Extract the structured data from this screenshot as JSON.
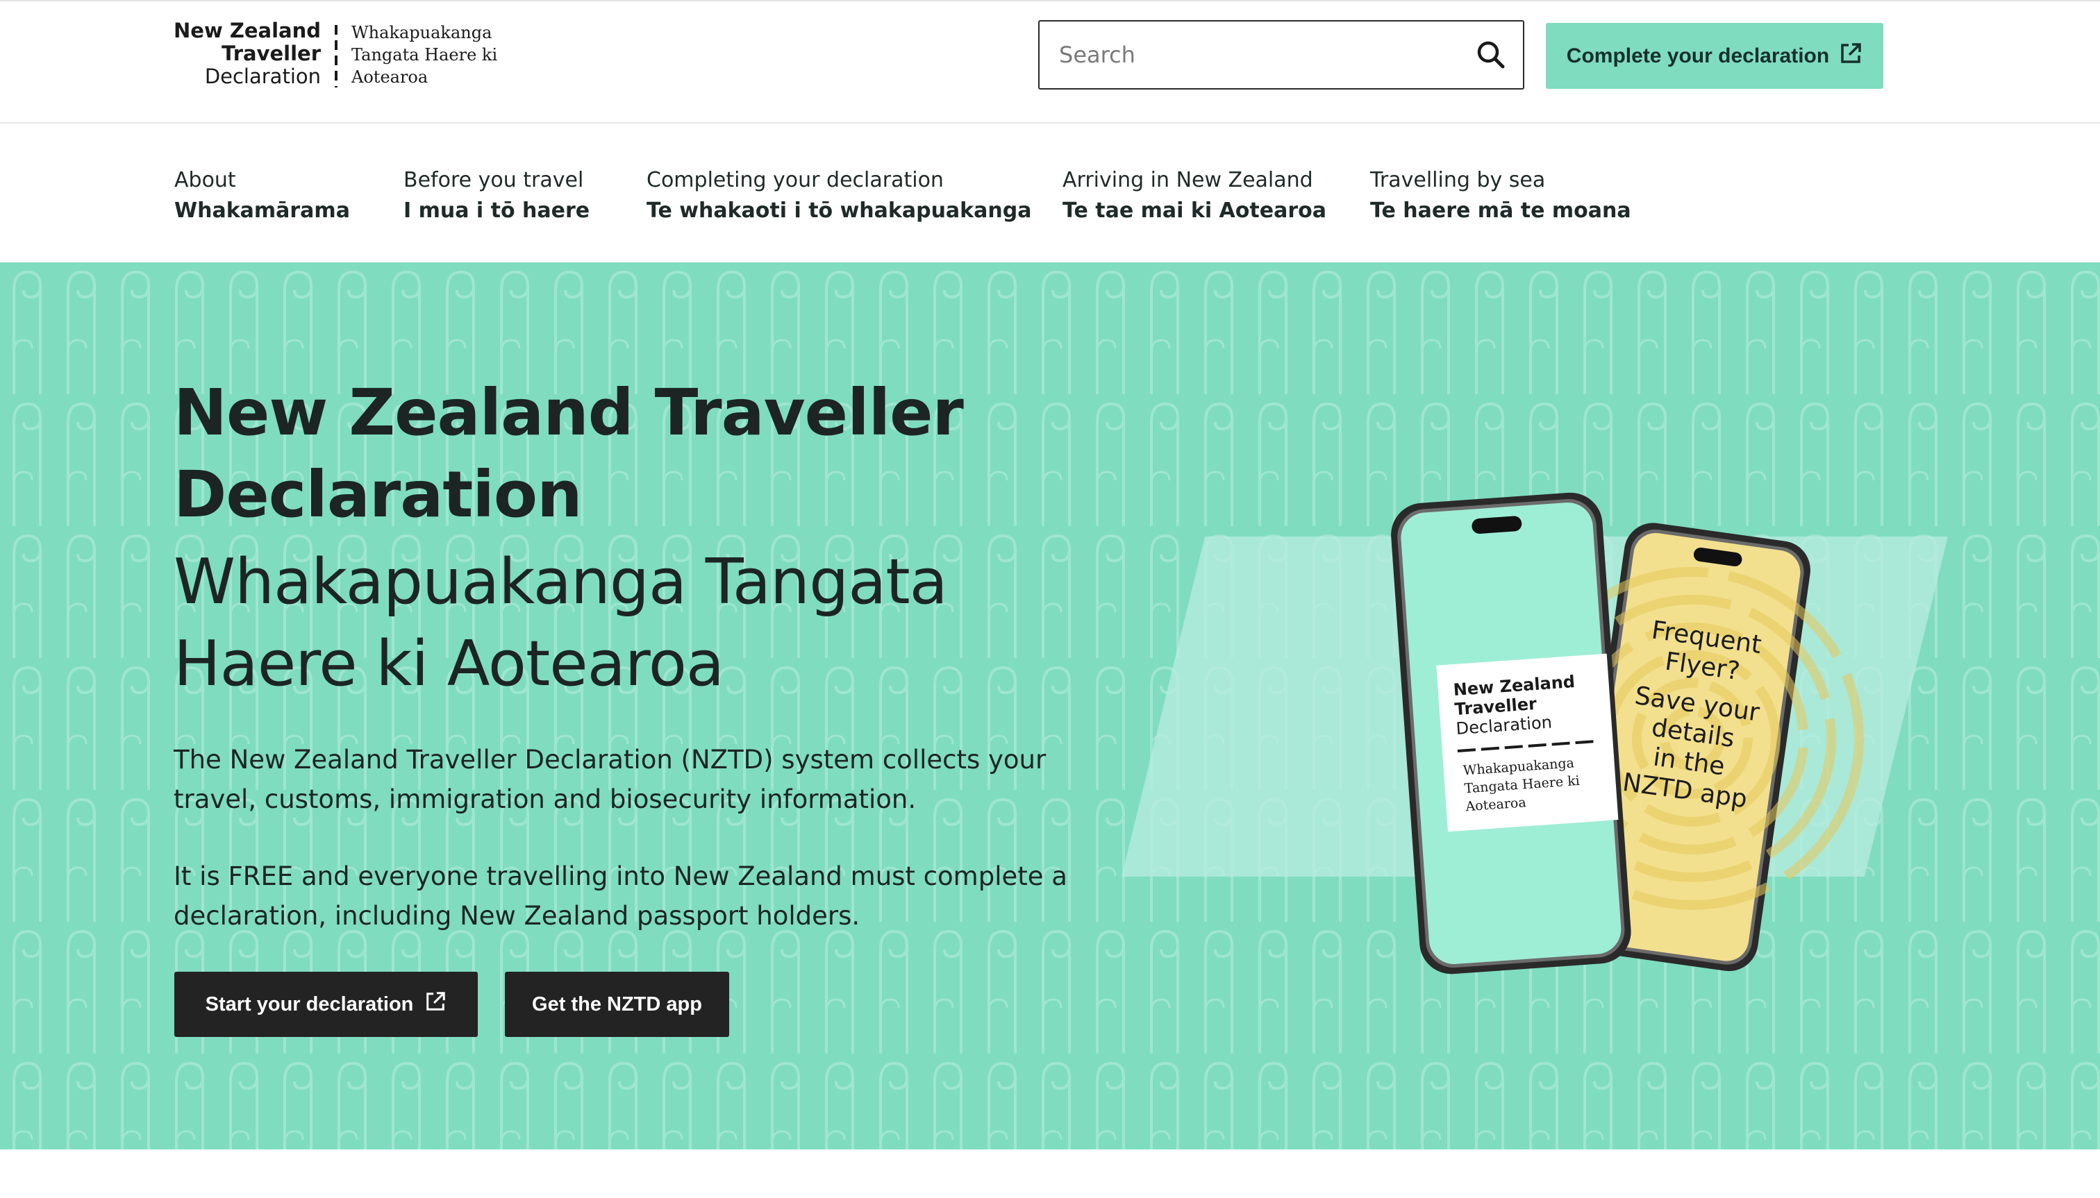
{
  "header": {
    "logo": {
      "en_line1": "New Zealand",
      "en_line2": "Traveller",
      "en_line3": "Declaration",
      "mi_line1": "Whakapuakanga",
      "mi_line2": "Tangata Haere ki",
      "mi_line3": "Aotearoa"
    },
    "search": {
      "placeholder": "Search",
      "icon": "search-icon"
    },
    "cta": {
      "label": "Complete your declaration",
      "icon": "external-link-icon"
    }
  },
  "nav": {
    "items": [
      {
        "en": "About",
        "mi": "Whakamārama"
      },
      {
        "en": "Before you travel",
        "mi": "I mua i tō haere"
      },
      {
        "en": "Completing your declaration",
        "mi": "Te whakaoti i tō whakapuakanga"
      },
      {
        "en": "Arriving in New Zealand",
        "mi": "Te tae mai ki Aotearoa"
      },
      {
        "en": "Travelling by sea",
        "mi": "Te haere mā te moana"
      }
    ]
  },
  "hero": {
    "title": "New Zealand Traveller Declaration",
    "subtitle": "Whakapuakanga Tangata Haere ki Aotearoa",
    "paragraph1": "The New Zealand Traveller Declaration (NZTD) system collects your travel, customs, immigration and biosecurity information.",
    "paragraph2": "It is FREE and everyone travelling into New Zealand must complete a declaration, including New Zealand passport holders.",
    "start_button": {
      "label": "Start your declaration",
      "icon": "external-link-icon"
    },
    "app_button": {
      "label": "Get the NZTD app"
    },
    "phone_left": {
      "card_en1": "New Zealand",
      "card_en2": "Traveller",
      "card_en3": "Declaration",
      "card_mi1": "Whakapuakanga",
      "card_mi2": "Tangata Haere ki",
      "card_mi3": "Aotearoa"
    },
    "phone_right": {
      "line1": "Frequent",
      "line2": "Flyer?",
      "line3": "Save your",
      "line4": "details",
      "line5": "in the",
      "line6": "NZTD app"
    }
  },
  "colors": {
    "accent": "#7fdcbf",
    "dark_button": "#232323",
    "phone_screen_left": "#9eeed5",
    "phone_screen_right": "#f3e08e"
  }
}
